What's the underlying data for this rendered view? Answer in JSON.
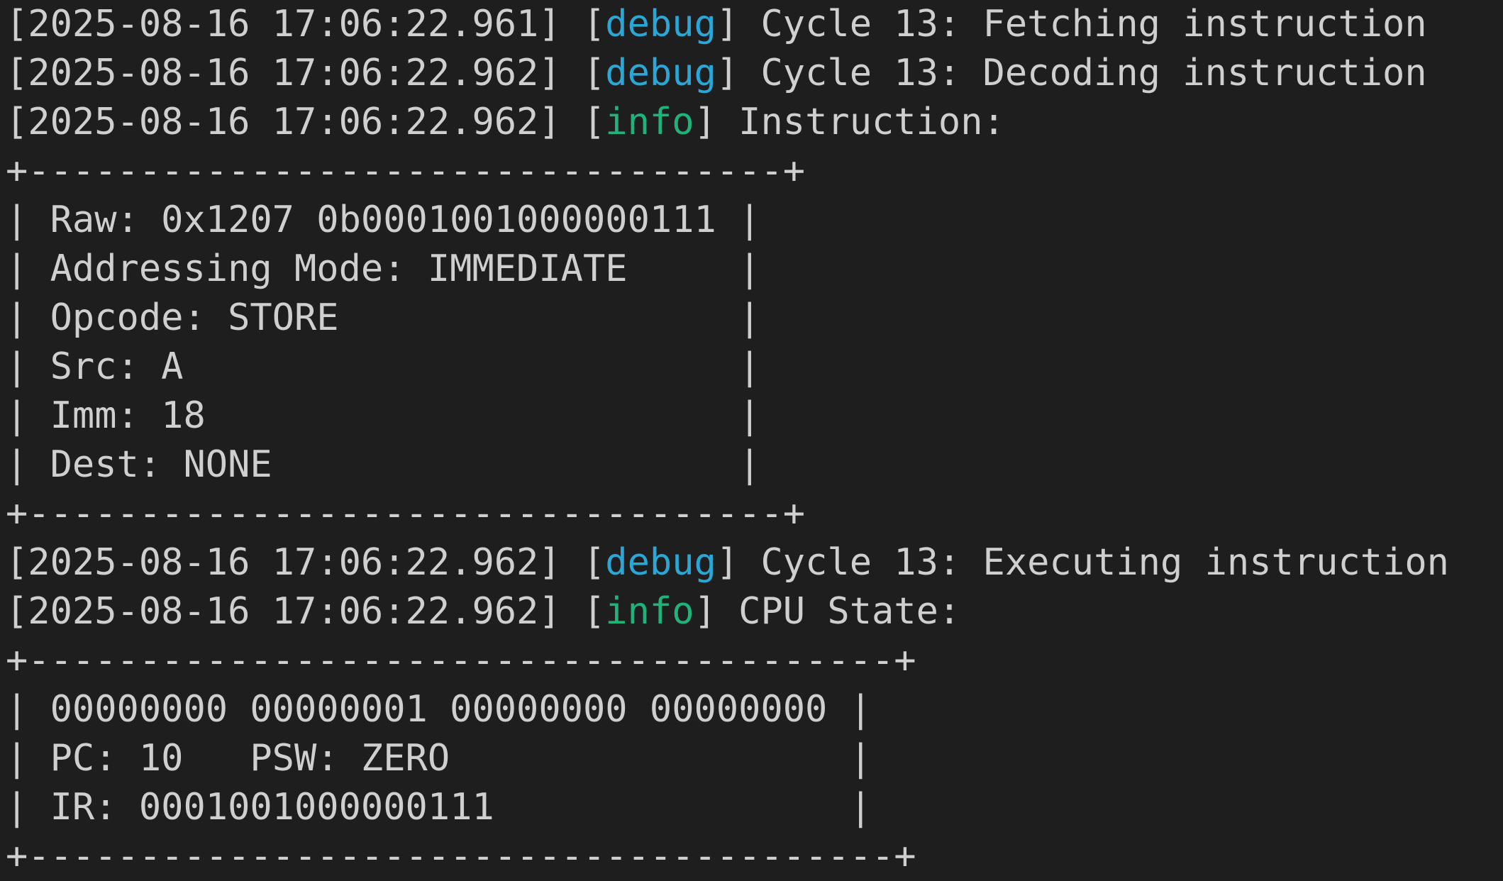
{
  "colors": {
    "background": "#1e1e1e",
    "foreground": "#cfcfcf",
    "debug": "#2aa7d6",
    "info": "#1fb37a"
  },
  "lines": [
    {
      "kind": "log",
      "timestamp": "[2025-08-16 17:06:22.961]",
      "level": "debug",
      "message": "Cycle 13: Fetching instruction"
    },
    {
      "kind": "log",
      "timestamp": "[2025-08-16 17:06:22.962]",
      "level": "debug",
      "message": "Cycle 13: Decoding instruction"
    },
    {
      "kind": "log",
      "timestamp": "[2025-08-16 17:06:22.962]",
      "level": "info",
      "message": "Instruction:"
    },
    {
      "kind": "text",
      "text": "+----------------------------------+"
    },
    {
      "kind": "text",
      "text": "| Raw: 0x1207 0b0001001000000111 |"
    },
    {
      "kind": "text",
      "text": "| Addressing Mode: IMMEDIATE     |"
    },
    {
      "kind": "text",
      "text": "| Opcode: STORE                  |"
    },
    {
      "kind": "text",
      "text": "| Src: A                         |"
    },
    {
      "kind": "text",
      "text": "| Imm: 18                        |"
    },
    {
      "kind": "text",
      "text": "| Dest: NONE                     |"
    },
    {
      "kind": "text",
      "text": "+----------------------------------+"
    },
    {
      "kind": "log",
      "timestamp": "[2025-08-16 17:06:22.962]",
      "level": "debug",
      "message": "Cycle 13: Executing instruction"
    },
    {
      "kind": "log",
      "timestamp": "[2025-08-16 17:06:22.962]",
      "level": "info",
      "message": "CPU State:"
    },
    {
      "kind": "text",
      "text": "+---------------------------------------+"
    },
    {
      "kind": "text",
      "text": "| 00000000 00000001 00000000 00000000 |"
    },
    {
      "kind": "text",
      "text": "| PC: 10   PSW: ZERO                  |"
    },
    {
      "kind": "text",
      "text": "| IR: 0001001000000111                |"
    },
    {
      "kind": "text",
      "text": "+---------------------------------------+"
    }
  ]
}
